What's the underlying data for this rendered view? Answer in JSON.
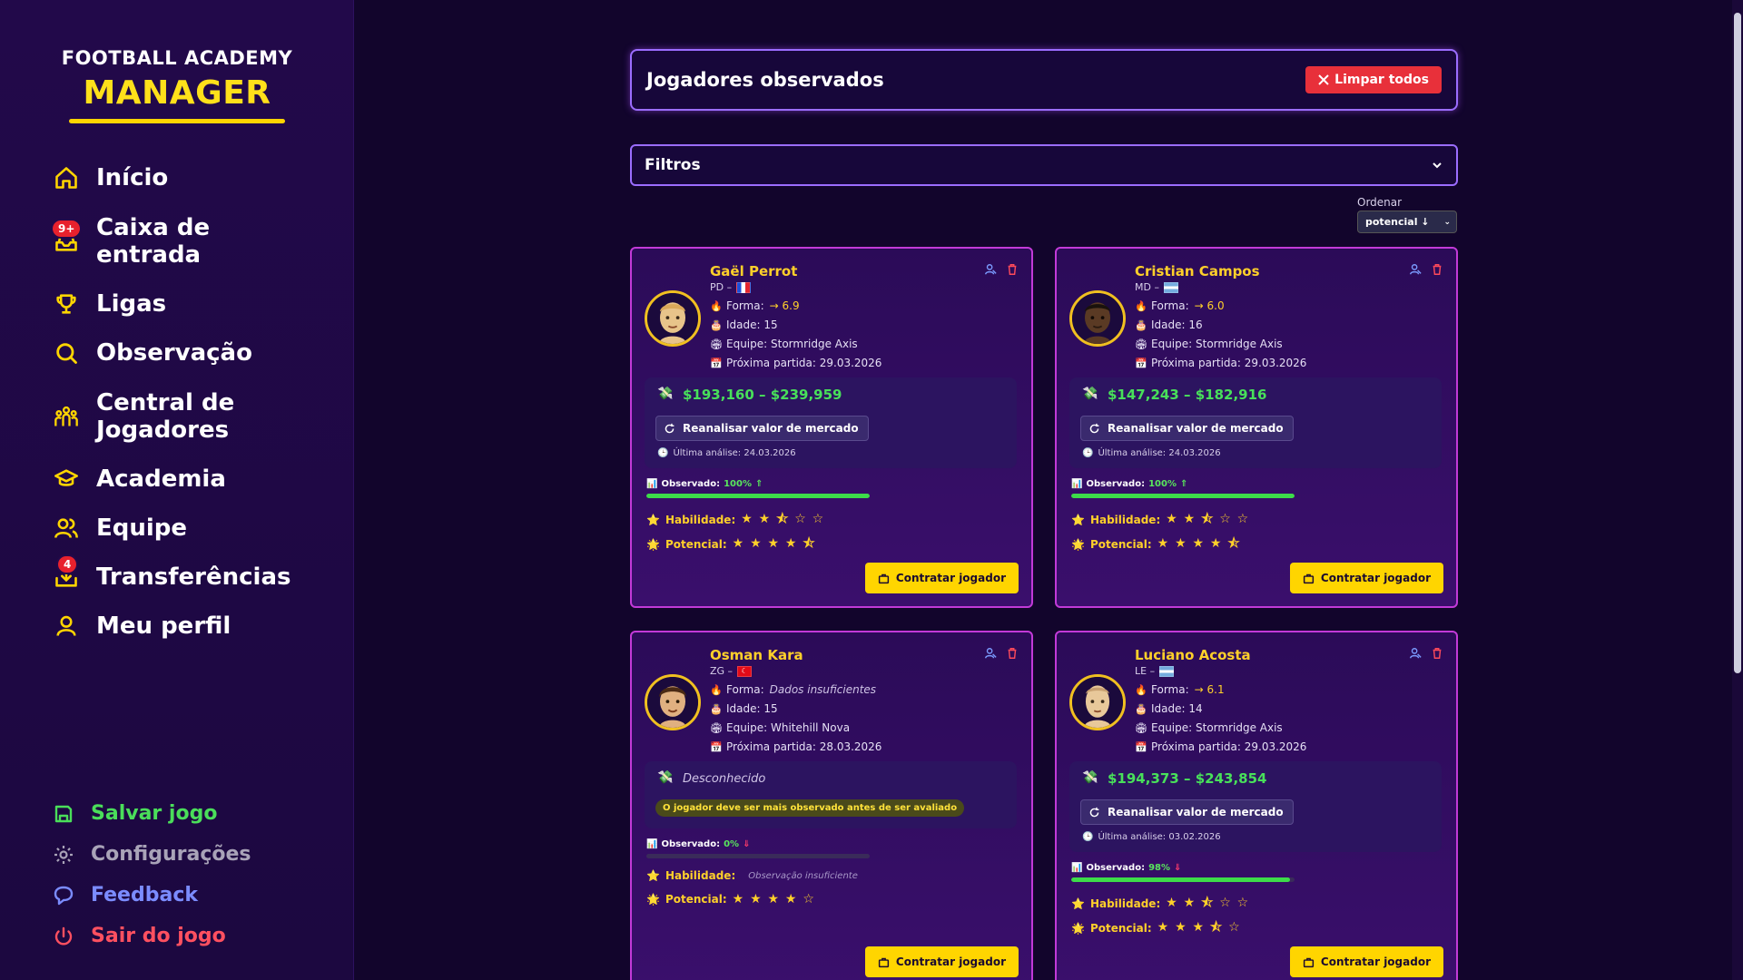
{
  "app": {
    "logo_top": "FOOTBALL ACADEMY",
    "logo_main": "MANAGER"
  },
  "nav": [
    {
      "label": "Início",
      "icon": "home-icon",
      "badge": null
    },
    {
      "label": "Caixa de entrada",
      "icon": "inbox-icon",
      "badge": "9+"
    },
    {
      "label": "Ligas",
      "icon": "trophy-icon",
      "badge": null
    },
    {
      "label": "Observação",
      "icon": "search-icon",
      "badge": null
    },
    {
      "label": "Central de Jogadores",
      "icon": "players-icon",
      "badge": null
    },
    {
      "label": "Academia",
      "icon": "graduation-cap-icon",
      "badge": null
    },
    {
      "label": "Equipe",
      "icon": "team-icon",
      "badge": null
    },
    {
      "label": "Transferências",
      "icon": "transfer-icon",
      "badge": "4"
    },
    {
      "label": "Meu perfil",
      "icon": "user-icon",
      "badge": null
    }
  ],
  "bottom_nav": [
    {
      "label": "Salvar jogo",
      "icon": "save-icon",
      "color": "#4ade5a"
    },
    {
      "label": "Configurações",
      "icon": "gear-icon",
      "color": "#a9a3b8"
    },
    {
      "label": "Feedback",
      "icon": "chat-icon",
      "color": "#7b8cff"
    },
    {
      "label": "Sair do jogo",
      "icon": "power-icon",
      "color": "#ff5060"
    }
  ],
  "main": {
    "title": "Jogadores observados",
    "clear_all": "Limpar todos",
    "filters": "Filtros",
    "sort_label": "Ordenar",
    "sort_value": "potencial ↓"
  },
  "cards": [
    {
      "name": "Gaël Perrot",
      "position": "PD –",
      "flag": "fr",
      "form_label": "Forma:",
      "form_value": "→ 6.9",
      "form_na": null,
      "age": "Idade: 15",
      "team": "Equipe: Stormridge Axis",
      "next_match": "Próxima partida: 29.03.2026",
      "value_range": "$193,160 – $239,959",
      "reanalyze": "Reanalisar valor de mercado",
      "last_analysis": "Última análise: 24.03.2026",
      "observed_label": "Observado:",
      "observed_pct": "100%",
      "observed_value": 100,
      "observed_trend": "up",
      "skill_label": "Habilidade:",
      "skill_stars": "★ ★ ⯪ ☆ ☆",
      "skill_rating": 2.5,
      "potential_label": "Potencial:",
      "potential_stars": "★ ★ ★ ★ ⯪",
      "potential_rating": 4.5,
      "hire": "Contratar jogador"
    },
    {
      "name": "Cristian Campos",
      "position": "MD –",
      "flag": "ar",
      "form_label": "Forma:",
      "form_value": "→ 6.0",
      "form_na": null,
      "age": "Idade: 16",
      "team": "Equipe: Stormridge Axis",
      "next_match": "Próxima partida: 29.03.2026",
      "value_range": "$147,243 – $182,916",
      "reanalyze": "Reanalisar valor de mercado",
      "last_analysis": "Última análise: 24.03.2026",
      "observed_label": "Observado:",
      "observed_pct": "100%",
      "observed_value": 100,
      "observed_trend": "up",
      "skill_label": "Habilidade:",
      "skill_stars": "★ ★ ⯪ ☆ ☆",
      "skill_rating": 2.5,
      "potential_label": "Potencial:",
      "potential_stars": "★ ★ ★ ★ ⯪",
      "potential_rating": 4.5,
      "hire": "Contratar jogador"
    },
    {
      "name": "Osman Kara",
      "position": "ZG –",
      "flag": "tr",
      "form_label": "Forma:",
      "form_value": null,
      "form_na": "Dados insuficientes",
      "age": "Idade: 15",
      "team": "Equipe: Whitehill Nova",
      "next_match": "Próxima partida: 28.03.2026",
      "unknown_value": "Desconhecido",
      "warning": "O jogador deve ser mais observado antes de ser avaliado",
      "observed_label": "Observado:",
      "observed_pct": "0%",
      "observed_value": 0,
      "observed_trend": "down",
      "skill_label": "Habilidade:",
      "skill_insufficient": "Observação insuficiente",
      "potential_label": "Potencial:",
      "potential_stars": "★ ★ ★ ★ ☆",
      "potential_rating": 4,
      "hire": "Contratar jogador"
    },
    {
      "name": "Luciano Acosta",
      "position": "LE –",
      "flag": "ar",
      "form_label": "Forma:",
      "form_value": "→ 6.1",
      "form_na": null,
      "age": "Idade: 14",
      "team": "Equipe: Stormridge Axis",
      "next_match": "Próxima partida: 29.03.2026",
      "value_range": "$194,373 – $243,854",
      "reanalyze": "Reanalisar valor de mercado",
      "last_analysis": "Última análise: 03.02.2026",
      "observed_label": "Observado:",
      "observed_pct": "98%",
      "observed_value": 98,
      "observed_trend": "down",
      "skill_label": "Habilidade:",
      "skill_stars": "★ ★ ⯪ ☆ ☆",
      "skill_rating": 2.5,
      "potential_label": "Potencial:",
      "potential_stars": "★ ★ ★ ⯪ ☆",
      "potential_rating": 3.5,
      "hire": "Contratar jogador"
    }
  ]
}
